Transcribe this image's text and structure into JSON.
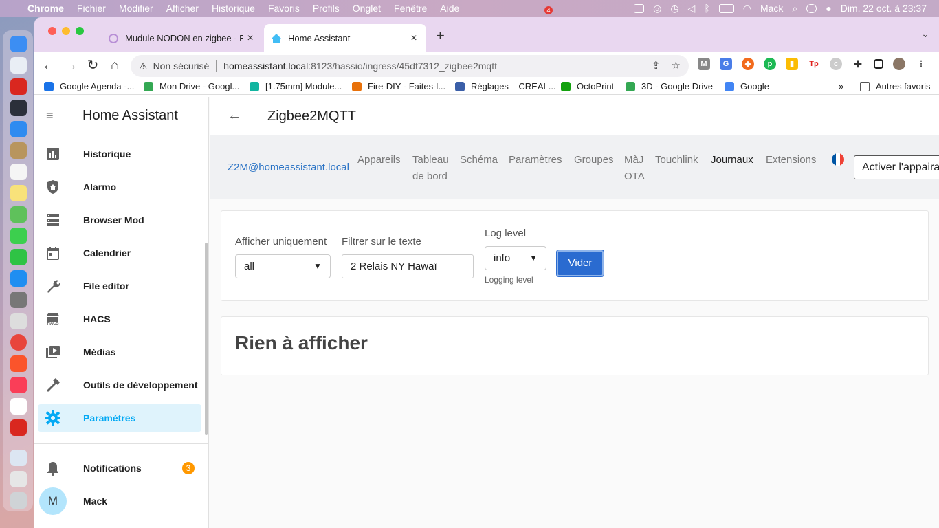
{
  "menubar": {
    "app": "Chrome",
    "items": [
      "Fichier",
      "Modifier",
      "Afficher",
      "Historique",
      "Favoris",
      "Profils",
      "Onglet",
      "Fenêtre",
      "Aide"
    ],
    "user": "Mack",
    "datetime": "Dim. 22 oct. à  23:37",
    "badge": "4"
  },
  "browser": {
    "tabs": [
      {
        "title": "Mudule NODON en zigbee - E",
        "active": false
      },
      {
        "title": "Home Assistant",
        "active": true
      }
    ],
    "address": {
      "security": "Non sécurisé",
      "host": "homeassistant.local",
      "path": ":8123/hassio/ingress/45df7312_zigbee2mqtt"
    },
    "bookmarks": [
      {
        "label": "Google Agenda -...",
        "color": "#1a73e8"
      },
      {
        "label": "Mon Drive - Googl...",
        "color": "#34a853"
      },
      {
        "label": "[1.75mm] Module...",
        "color": "#12b5a0"
      },
      {
        "label": "Fire-DIY - Faites-l...",
        "color": "#e8710a"
      },
      {
        "label": "Réglages – CREAL...",
        "color": "#3b5fa8"
      },
      {
        "label": "OctoPrint",
        "color": "#13a10e"
      },
      {
        "label": "3D - Google Drive",
        "color": "#34a853"
      },
      {
        "label": "Google",
        "color": "#4285f4"
      }
    ],
    "other_bookmarks": "Autres favoris",
    "more": "»"
  },
  "sidebar": {
    "title": "Home Assistant",
    "items": [
      {
        "label": "Historique",
        "icon": "chart-icon"
      },
      {
        "label": "Alarmo",
        "icon": "shield-home-icon"
      },
      {
        "label": "Browser Mod",
        "icon": "server-icon"
      },
      {
        "label": "Calendrier",
        "icon": "calendar-icon"
      },
      {
        "label": "File editor",
        "icon": "wrench-icon"
      },
      {
        "label": "HACS",
        "icon": "hacs-icon"
      },
      {
        "label": "Médias",
        "icon": "media-icon"
      },
      {
        "label": "Outils de développement",
        "icon": "hammer-icon"
      },
      {
        "label": "Paramètres",
        "icon": "cog-icon",
        "active": true
      }
    ],
    "notifications": {
      "label": "Notifications",
      "count": "3"
    },
    "user": {
      "initial": "M",
      "name": "Mack"
    },
    "hacs_small": "HACS"
  },
  "main": {
    "title": "Zigbee2MQTT",
    "z2m": {
      "brand": "Z2M@homeassistant.local",
      "nav": [
        {
          "label": "Appareils"
        },
        {
          "label": "Tableau de bord"
        },
        {
          "label": "Schéma"
        },
        {
          "label": "Paramètres"
        },
        {
          "label": "Groupes"
        },
        {
          "label": "MàJ OTA"
        },
        {
          "label": "Touchlink"
        },
        {
          "label": "Journaux",
          "active": true
        },
        {
          "label": "Extensions"
        }
      ],
      "nav_lines": {
        "tableau_1": "Tableau",
        "tableau_2": "de bord",
        "maj_1": "MàJ",
        "maj_2": "OTA"
      },
      "pair_button": "Activer l'appairage"
    },
    "filters": {
      "show_only_label": "Afficher uniquement",
      "show_only_value": "all",
      "text_filter_label": "Filtrer sur le texte",
      "text_filter_value": "2 Relais NY Hawaï",
      "log_level_label": "Log level",
      "log_level_value": "info",
      "log_level_help": "Logging level",
      "clear_button": "Vider"
    },
    "empty_message": "Rien à afficher"
  },
  "colors": {
    "ha_accent": "#03a9f4",
    "z2m_link": "#2a73c5",
    "primary_button": "#2a6bd0",
    "badge": "#ff9800"
  }
}
